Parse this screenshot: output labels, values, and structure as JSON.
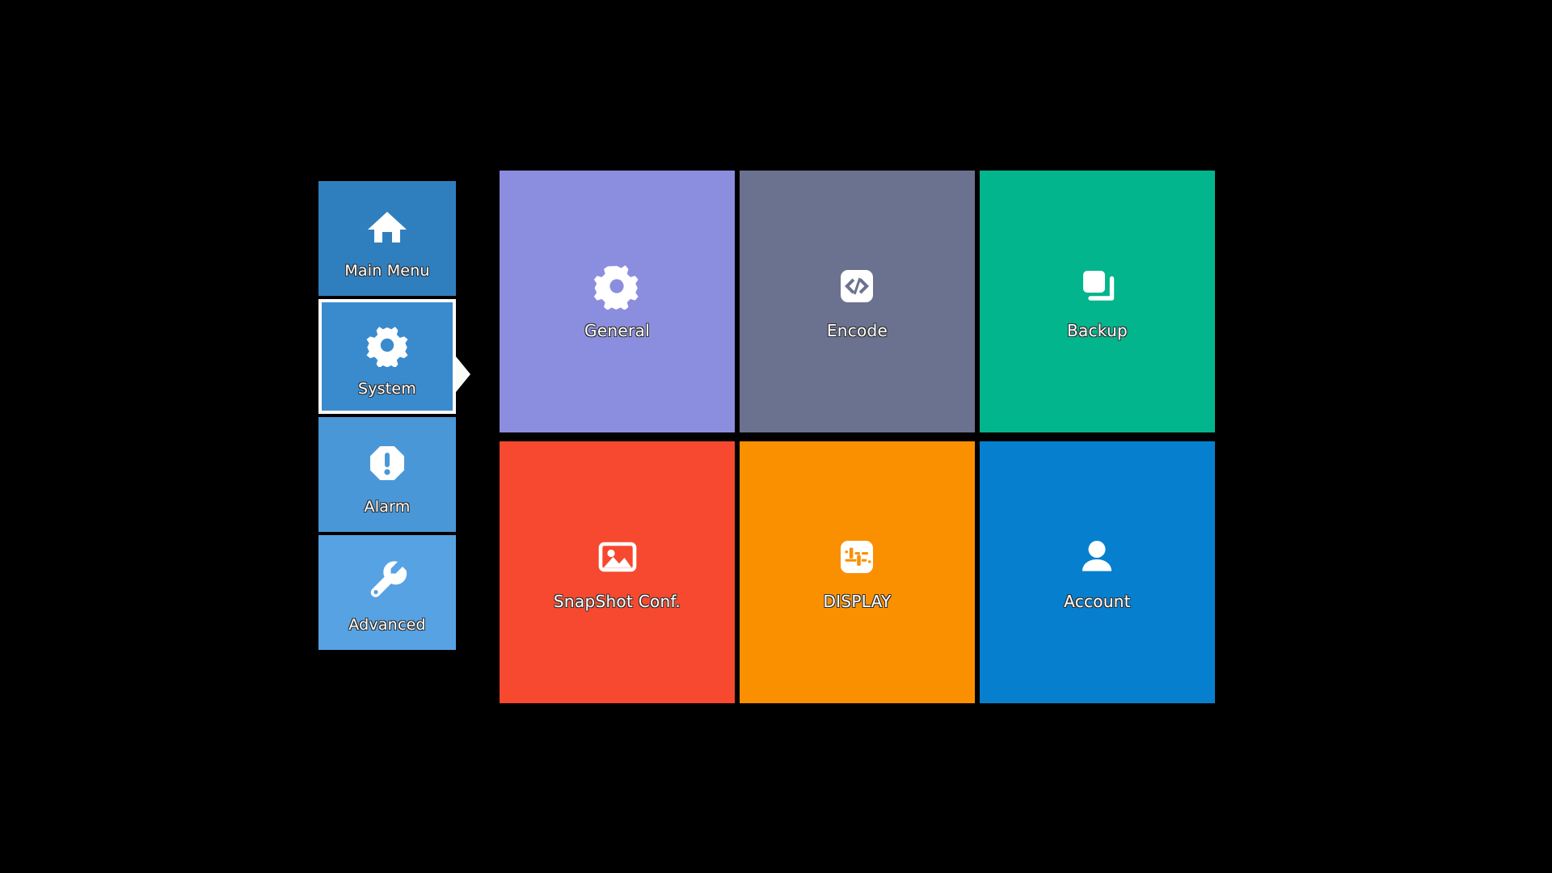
{
  "screen": {
    "background_color": "#000000",
    "label_text_color": "#ffffff"
  },
  "sidebar": {
    "selected_index": 1,
    "selection_arrow_icon": "triangle-right-icon",
    "items": [
      {
        "label": "Main Menu",
        "icon": "home-icon",
        "color": "#2f7fbf",
        "selected": false
      },
      {
        "label": "System",
        "icon": "gear-icon",
        "color": "#3a8bce",
        "selected": true
      },
      {
        "label": "Alarm",
        "icon": "alert-octagon-icon",
        "color": "#4a97d8",
        "selected": false
      },
      {
        "label": "Advanced",
        "icon": "wrench-icon",
        "color": "#57a2e2",
        "selected": false
      }
    ]
  },
  "grid": {
    "tiles": [
      {
        "label": "General",
        "icon": "gear-icon",
        "color": "#8b8ede"
      },
      {
        "label": "Encode",
        "icon": "code-icon",
        "color": "#6b7290"
      },
      {
        "label": "Backup",
        "icon": "copy-layers-icon",
        "color": "#03b58c"
      },
      {
        "label": "SnapShot Conf.",
        "icon": "image-icon",
        "color": "#f6492f"
      },
      {
        "label": "DISPLAY",
        "icon": "sliders-icon",
        "color": "#fa9000"
      },
      {
        "label": "Account",
        "icon": "user-icon",
        "color": "#0680ce"
      }
    ]
  }
}
